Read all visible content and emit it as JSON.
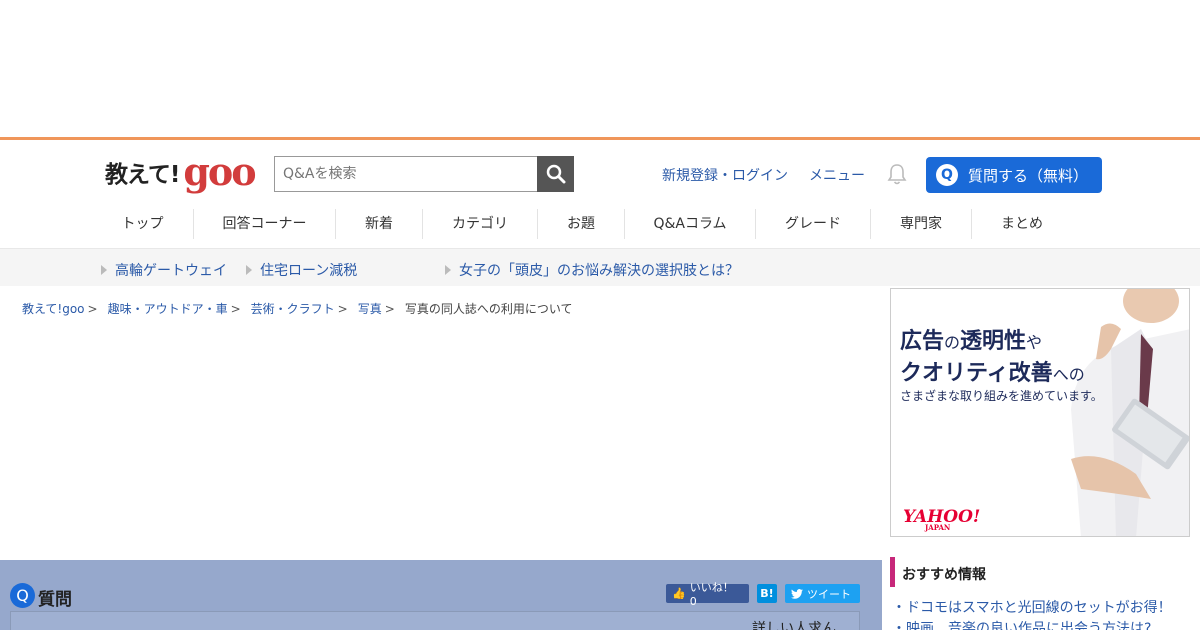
{
  "logo": {
    "text": "教えて!",
    "brand": "goo"
  },
  "search": {
    "placeholder": "Q&Aを検索"
  },
  "header": {
    "register_login": "新規登録・ログイン",
    "menu": "メニュー",
    "ask_button": "質問する（無料）",
    "ask_q": "Q"
  },
  "nav": [
    {
      "label": "トップ"
    },
    {
      "label": "回答コーナー"
    },
    {
      "label": "新着"
    },
    {
      "label": "カテゴリ"
    },
    {
      "label": "お題"
    },
    {
      "label": "Q&Aコラム"
    },
    {
      "label": "グレード"
    },
    {
      "label": "専門家"
    },
    {
      "label": "まとめ"
    }
  ],
  "subbar": [
    {
      "label": "高輪ゲートウェイ"
    },
    {
      "label": "住宅ローン減税"
    },
    {
      "label": "女子の「頭皮」のお悩み解決の選択肢とは？"
    }
  ],
  "breadcrumb": {
    "items": [
      "教えて!goo",
      "趣味・アウトドア・車",
      "芸術・クラフト",
      "写真"
    ],
    "separator": ">",
    "current": "写真の同人誌への利用について"
  },
  "ad": {
    "line1_a": "広告",
    "line1_b": "の",
    "line1_c": "透明性",
    "line1_d": "や",
    "line2_a": "クオリティ改善",
    "line2_b": "への",
    "line3": "さまざまな取り組みを進めています。",
    "brand": "YAHOO!",
    "brand_sub": "JAPAN"
  },
  "question": {
    "badge": "Q",
    "label": "質問",
    "like": "いいね！ 0",
    "hatena": "B!",
    "tweet": "ツイート",
    "partial_text": "詳しい人求ん"
  },
  "recommend": {
    "title": "おすすめ情報",
    "items": [
      "・ドコモはスマホと光回線のセットがお得！",
      "・映画、音楽の良い作品に出会う方法は?"
    ]
  },
  "colors": {
    "accent_orange": "#f0965a",
    "link_blue": "#2b5aa8",
    "button_blue": "#1a6ad8",
    "goo_red": "#d23c3c",
    "recommend_pink": "#c7287a"
  }
}
